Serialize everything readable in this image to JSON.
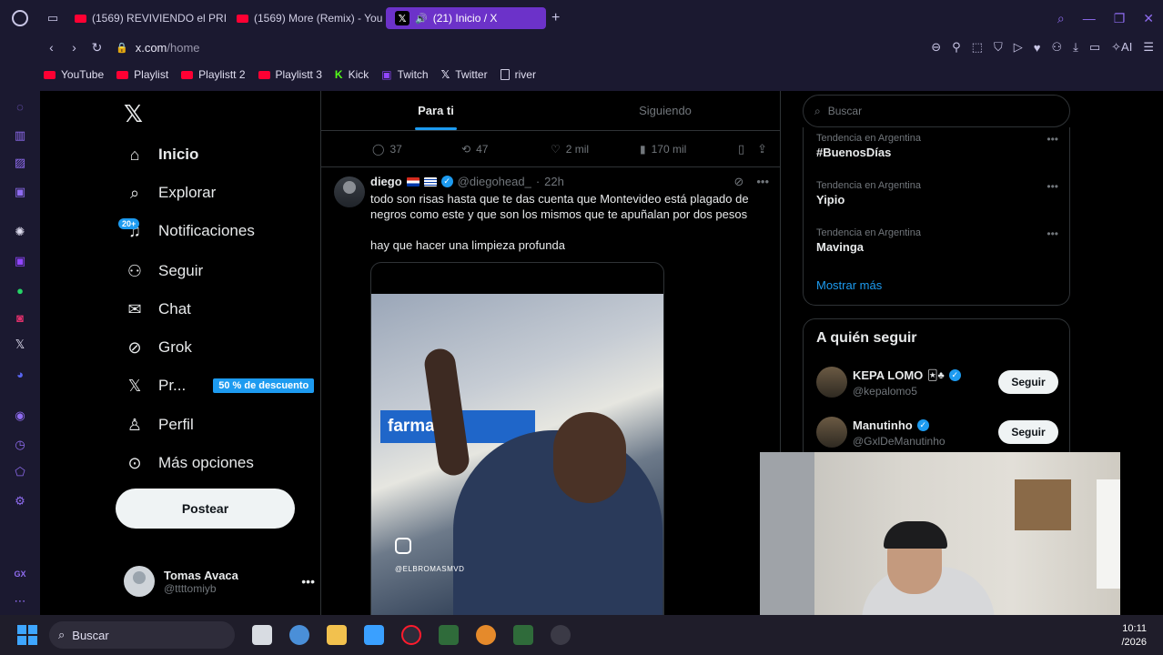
{
  "browser": {
    "tabs": [
      {
        "label": "(1569) REVIVIENDO el PRI",
        "type": "youtube",
        "active": false
      },
      {
        "label": "(1569) More (Remix) - You",
        "type": "youtube",
        "active": false
      },
      {
        "label": "(21) Inicio / X",
        "type": "x",
        "active": true
      }
    ],
    "url_host": "x.com",
    "url_path": "/home",
    "bookmarks": [
      "YouTube",
      "Playlist",
      "Playlistt 2",
      "Playlistt 3",
      "Kick",
      "Twitch",
      "Twitter",
      "river"
    ],
    "ai_label": "AI"
  },
  "x": {
    "logo": "X",
    "nav": [
      {
        "label": "Inicio",
        "icon": "home-icon"
      },
      {
        "label": "Explorar",
        "icon": "search-icon"
      },
      {
        "label": "Notificaciones",
        "icon": "bell-icon"
      },
      {
        "label": "Seguir",
        "icon": "follow-icon"
      },
      {
        "label": "Chat",
        "icon": "mail-icon"
      },
      {
        "label": "Grok",
        "icon": "grok-icon"
      },
      {
        "label": "Pr...",
        "icon": "x-icon"
      },
      {
        "label": "Perfil",
        "icon": "person-icon"
      },
      {
        "label": "Más opciones",
        "icon": "more-icon"
      }
    ],
    "notif_badge": "20+",
    "premium_promo": "50 % de descuento",
    "post_button": "Postear",
    "account": {
      "name": "Tomas Avaca",
      "handle": "@ttttomiyb"
    },
    "feed_tabs": [
      "Para ti",
      "Siguiendo"
    ],
    "prev_actions": {
      "replies": "37",
      "reposts": "47",
      "likes": "2 mil",
      "views": "170 mil"
    },
    "tweet": {
      "name": "diego",
      "handle": "@diegohead_",
      "time": "22h",
      "text1": "todo son risas hasta que te das cuenta que Montevideo está plagado de negros como este y que son los mismos que te apuñalan por dos pesos",
      "text2": "hay que hacer una limpieza profunda",
      "video_sign": "farma",
      "video_watermark": "@ELBROMASMVD"
    },
    "search_placeholder": "Buscar",
    "trends": [
      {
        "category": "Tendencia en Argentina",
        "name": "#BuenosDías"
      },
      {
        "category": "Tendencia en Argentina",
        "name": "Yipio"
      },
      {
        "category": "Tendencia en Argentina",
        "name": "Mavinga"
      }
    ],
    "show_more": "Mostrar más",
    "who_to_follow_title": "A quién seguir",
    "who_to_follow": [
      {
        "name": "KEPA LOMO",
        "handle": "@kepalomo5",
        "button": "Seguir"
      },
      {
        "name": "Manutinho",
        "handle": "@GxlDeManutinho",
        "button": "Seguir"
      }
    ]
  },
  "taskbar": {
    "search_label": "Buscar",
    "time": "10:11",
    "date": "/2026"
  },
  "colors": {
    "accent": "#1d9bf0",
    "opera_purple": "#6c32c9",
    "chrome_bg": "#1b1930"
  }
}
